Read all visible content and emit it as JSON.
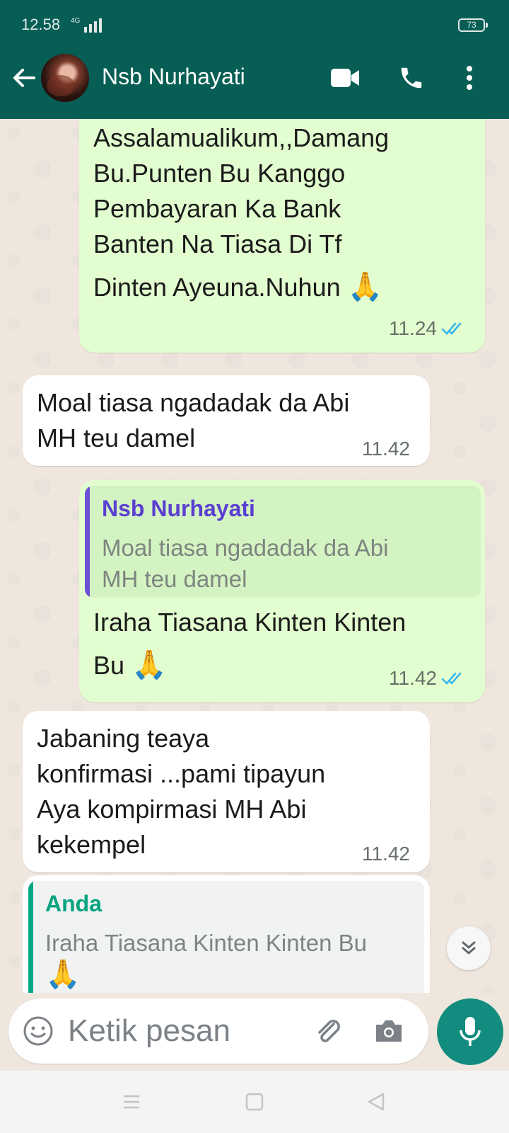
{
  "status_bar": {
    "time": "12.58",
    "network": "4G",
    "battery": "73"
  },
  "header": {
    "contact_name": "Nsb Nurhayati"
  },
  "messages": [
    {
      "direction": "out",
      "text": [
        "Assalamualikum,,Damang",
        "Bu.Punten Bu Kanggo",
        "Pembayaran Ka Bank",
        "Banten Na Tiasa Di Tf",
        "Dinten Ayeuna.Nuhun"
      ],
      "emoji": "🙏",
      "time": "11.24",
      "read": true
    },
    {
      "direction": "in",
      "text": [
        "Moal tiasa ngadadak da Abi",
        "MH teu damel"
      ],
      "time": "11.42"
    },
    {
      "direction": "out",
      "quote": {
        "name": "Nsb Nurhayati",
        "text": [
          "Moal tiasa ngadadak da Abi",
          "MH teu damel"
        ]
      },
      "text": [
        "Iraha Tiasana Kinten Kinten",
        "Bu"
      ],
      "emoji": "🙏",
      "time": "11.42",
      "read": true
    },
    {
      "direction": "in",
      "text": [
        "Jabaning teaya",
        "konfirmasi ...pami tipayun",
        "Aya kompirmasi MH Abi",
        "kekempel"
      ],
      "time": "11.42"
    },
    {
      "direction": "in",
      "quote": {
        "name": "Anda",
        "text": [
          "Iraha Tiasana Kinten Kinten Bu"
        ],
        "emoji": "🙏"
      }
    }
  ],
  "composer": {
    "placeholder": "Ketik pesan"
  },
  "colors": {
    "header": "#075e54",
    "outgoing": "#e2fdcf",
    "incoming": "#ffffff",
    "accent": "#128c7e",
    "read_ticks": "#34b7f1"
  },
  "icons": [
    "back-arrow-icon",
    "video-call-icon",
    "phone-icon",
    "more-vert-icon",
    "emoji-icon",
    "attach-icon",
    "camera-icon",
    "mic-icon",
    "chevron-double-down-icon",
    "nav-menu-icon",
    "nav-home-icon",
    "nav-back-icon"
  ]
}
